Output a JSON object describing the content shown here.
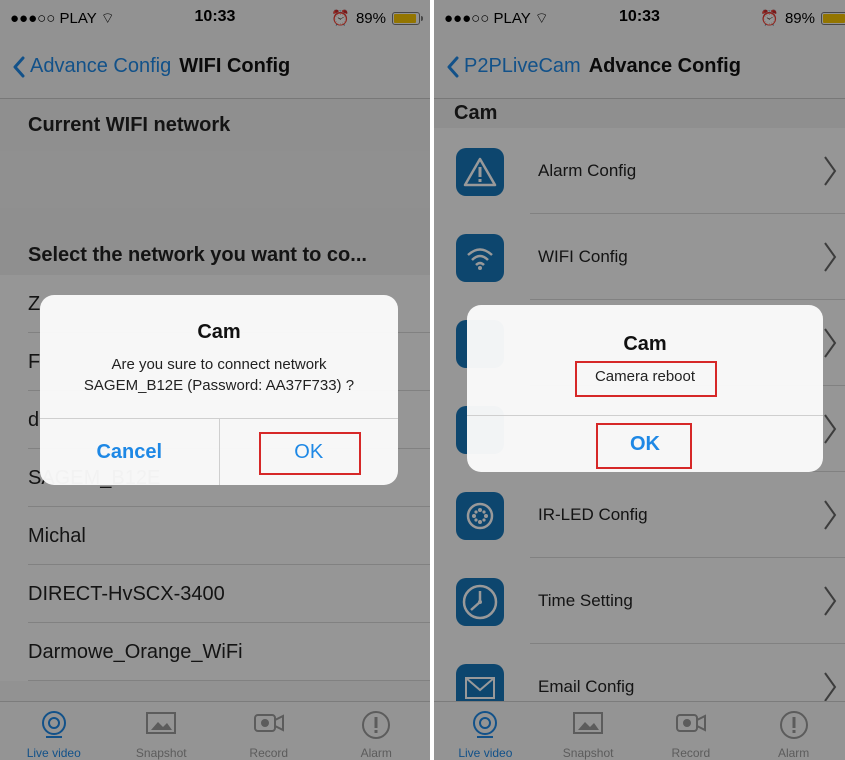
{
  "status": {
    "carrier": "●●●○○ PLAY",
    "time": "10:33",
    "battery": "89%"
  },
  "left": {
    "nav": {
      "back_label": "Advance Config",
      "title": "WIFI Config"
    },
    "current_header": "Current WIFI network",
    "select_header": "Select the network you want to co...",
    "networks": [
      "Z",
      "F",
      "d",
      "SAGEM_B12E",
      "Michal",
      "DIRECT-HvSCX-3400",
      "Darmowe_Orange_WiFi"
    ],
    "alert": {
      "title": "Cam",
      "message_line1": "Are you sure to connect network",
      "message_line2": "SAGEM_B12E (Password: AA37F733) ?",
      "cancel": "Cancel",
      "ok": "OK"
    }
  },
  "right": {
    "nav": {
      "back_label": "P2PLiveCam",
      "title": "Advance Config"
    },
    "section": "Cam",
    "items": [
      {
        "label": "Alarm Config",
        "icon": "alarm-warning-icon"
      },
      {
        "label": "WIFI Config",
        "icon": "wifi-icon"
      },
      {
        "label": "",
        "icon": "config-icon"
      },
      {
        "label": "",
        "icon": "config-icon"
      },
      {
        "label": "IR-LED Config",
        "icon": "ir-led-icon"
      },
      {
        "label": "Time Setting",
        "icon": "clock-icon"
      },
      {
        "label": "Email Config",
        "icon": "email-icon"
      }
    ],
    "alert": {
      "title": "Cam",
      "message": "Camera reboot",
      "ok": "OK"
    }
  },
  "tabs": [
    {
      "label": "Live video",
      "icon": "live-video-icon",
      "active": true
    },
    {
      "label": "Snapshot",
      "icon": "snapshot-icon",
      "active": false
    },
    {
      "label": "Record",
      "icon": "record-icon",
      "active": false
    },
    {
      "label": "Alarm",
      "icon": "alarm-icon",
      "active": false
    }
  ],
  "colors": {
    "accent": "#1e88e5",
    "highlight": "#d62828",
    "icon_bg": "#1675b8"
  }
}
